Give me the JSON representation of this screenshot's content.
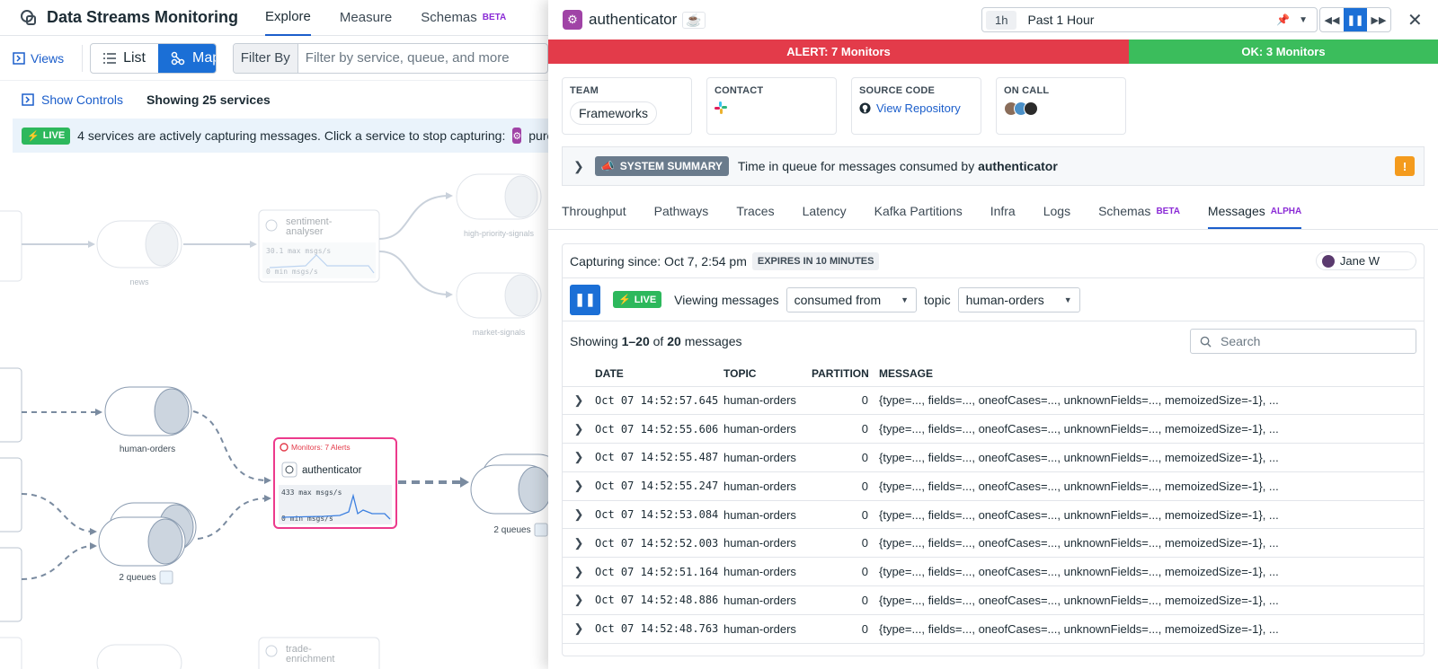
{
  "app": {
    "title": "Data Streams Monitoring",
    "nav": [
      {
        "label": "Explore",
        "active": true
      },
      {
        "label": "Measure"
      },
      {
        "label": "Schemas",
        "tag": "BETA"
      }
    ],
    "views_label": "Views",
    "view_modes": [
      "List",
      "Map"
    ],
    "active_view": "Map",
    "filter_label": "Filter By",
    "filter_placeholder": "Filter by service, queue, and more",
    "show_controls": "Show Controls",
    "showing_services": "Showing 25 services",
    "live_badge": "LIVE",
    "live_message": "4 services are actively capturing messages. Click a service to stop capturing:",
    "live_service": "purchas"
  },
  "map": {
    "nodes": {
      "sentiment": "sentiment-\nanalyser",
      "sentiment_max": "30.1 max msgs/s",
      "sentiment_min": "0 min msgs/s",
      "news": "news",
      "high_priority": "high-priority-signals",
      "market_signals": "market-signals",
      "human_orders": "human-orders",
      "queues_left": "2 queues",
      "queues_right": "2 queues",
      "auth_monitor": "Monitors: 7 Alerts",
      "auth_name": "authenticator",
      "auth_max": "433 max msgs/s",
      "auth_min": "0 min msgs/s",
      "trade": "trade-\nenrichment"
    }
  },
  "panel": {
    "service_name": "authenticator",
    "time_pill": "1h",
    "time_label": "Past 1 Hour",
    "alert_text": "ALERT: 7 Monitors",
    "ok_text": "OK: 3 Monitors",
    "cards": {
      "team_title": "TEAM",
      "team_value": "Frameworks",
      "contact_title": "CONTACT",
      "source_title": "SOURCE CODE",
      "source_link": "View Repository",
      "oncall_title": "ON CALL"
    },
    "summary_badge": "SYSTEM SUMMARY",
    "summary_text": "Time in queue for messages consumed by",
    "summary_service": "authenticator",
    "tabs": [
      {
        "label": "Throughput"
      },
      {
        "label": "Pathways"
      },
      {
        "label": "Traces"
      },
      {
        "label": "Latency"
      },
      {
        "label": "Kafka Partitions"
      },
      {
        "label": "Infra"
      },
      {
        "label": "Logs"
      },
      {
        "label": "Schemas",
        "tag": "BETA"
      },
      {
        "label": "Messages",
        "tag": "ALPHA",
        "active": true
      }
    ],
    "capturing_since": "Capturing since: Oct 7, 2:54 pm",
    "expires": "EXPIRES IN 10 MINUTES",
    "user": "Jane W",
    "live_badge": "LIVE",
    "viewing_label": "Viewing messages",
    "direction_value": "consumed from",
    "topic_label": "topic",
    "topic_value": "human-orders",
    "showing_prefix": "Showing",
    "showing_range": "1–20",
    "showing_of": "of",
    "showing_total": "20",
    "showing_suffix": "messages",
    "search_placeholder": "Search",
    "columns": [
      "DATE",
      "TOPIC",
      "PARTITION",
      "MESSAGE"
    ],
    "rows": [
      {
        "date": "Oct 07 14:52:57.645",
        "topic": "human-orders",
        "partition": "0",
        "message": "{type=..., fields=..., oneofCases=..., unknownFields=..., memoizedSize=-1}, ..."
      },
      {
        "date": "Oct 07 14:52:55.606",
        "topic": "human-orders",
        "partition": "0",
        "message": "{type=..., fields=..., oneofCases=..., unknownFields=..., memoizedSize=-1}, ..."
      },
      {
        "date": "Oct 07 14:52:55.487",
        "topic": "human-orders",
        "partition": "0",
        "message": "{type=..., fields=..., oneofCases=..., unknownFields=..., memoizedSize=-1}, ..."
      },
      {
        "date": "Oct 07 14:52:55.247",
        "topic": "human-orders",
        "partition": "0",
        "message": "{type=..., fields=..., oneofCases=..., unknownFields=..., memoizedSize=-1}, ..."
      },
      {
        "date": "Oct 07 14:52:53.084",
        "topic": "human-orders",
        "partition": "0",
        "message": "{type=..., fields=..., oneofCases=..., unknownFields=..., memoizedSize=-1}, ..."
      },
      {
        "date": "Oct 07 14:52:52.003",
        "topic": "human-orders",
        "partition": "0",
        "message": "{type=..., fields=..., oneofCases=..., unknownFields=..., memoizedSize=-1}, ..."
      },
      {
        "date": "Oct 07 14:52:51.164",
        "topic": "human-orders",
        "partition": "0",
        "message": "{type=..., fields=..., oneofCases=..., unknownFields=..., memoizedSize=-1}, ..."
      },
      {
        "date": "Oct 07 14:52:48.886",
        "topic": "human-orders",
        "partition": "0",
        "message": "{type=..., fields=..., oneofCases=..., unknownFields=..., memoizedSize=-1}, ..."
      },
      {
        "date": "Oct 07 14:52:48.763",
        "topic": "human-orders",
        "partition": "0",
        "message": "{type=..., fields=..., oneofCases=..., unknownFields=..., memoizedSize=-1}, ..."
      }
    ],
    "colors": {
      "alert": "#e33b4a",
      "ok": "#3bbd5c",
      "accent": "#1b6fd6",
      "service": "#a043a6"
    }
  }
}
